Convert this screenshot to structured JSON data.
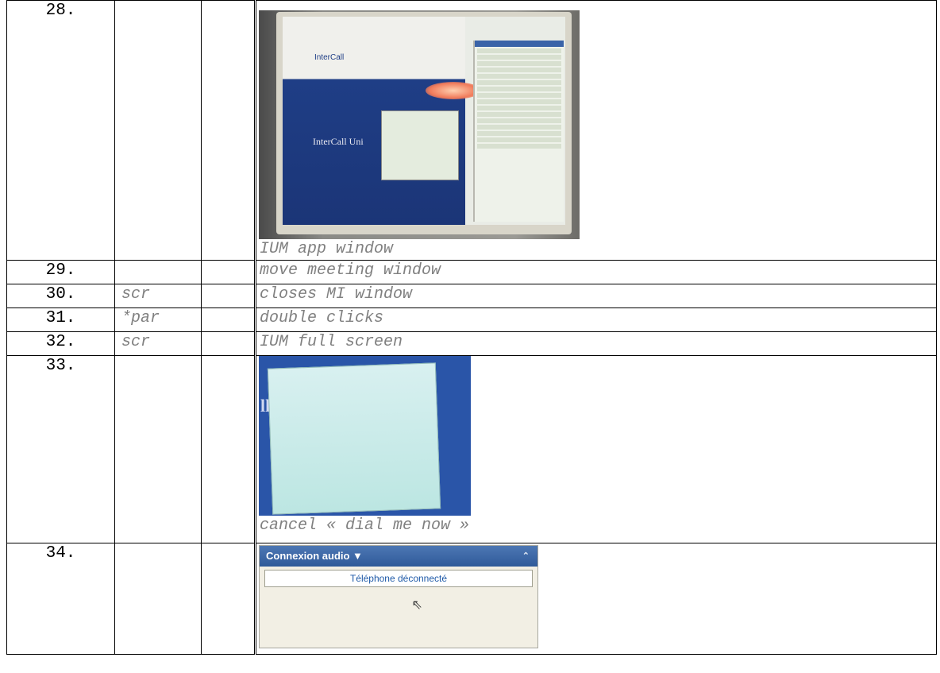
{
  "rows": [
    {
      "num": "28.",
      "code": "",
      "desc": "IUM app window"
    },
    {
      "num": "29.",
      "code": "",
      "desc": "move meeting window"
    },
    {
      "num": "30.",
      "code": "scr",
      "desc": "closes MI window"
    },
    {
      "num": "31.",
      "code": "*par",
      "desc": "double clicks"
    },
    {
      "num": "32.",
      "code": "scr",
      "desc": "IUM full screen"
    },
    {
      "num": "33.",
      "code": "",
      "desc": "cancel « dial me now »"
    },
    {
      "num": "34.",
      "code": "",
      "desc": ""
    }
  ],
  "photo1": {
    "logo": "InterCall",
    "slide_title": "InterCall Uni"
  },
  "photo2": {
    "slide_title": "ll Uni"
  },
  "audio_panel": {
    "title": "Connexion audio ▼",
    "collapse_icon": "⌃",
    "status": "Téléphone déconnecté"
  }
}
